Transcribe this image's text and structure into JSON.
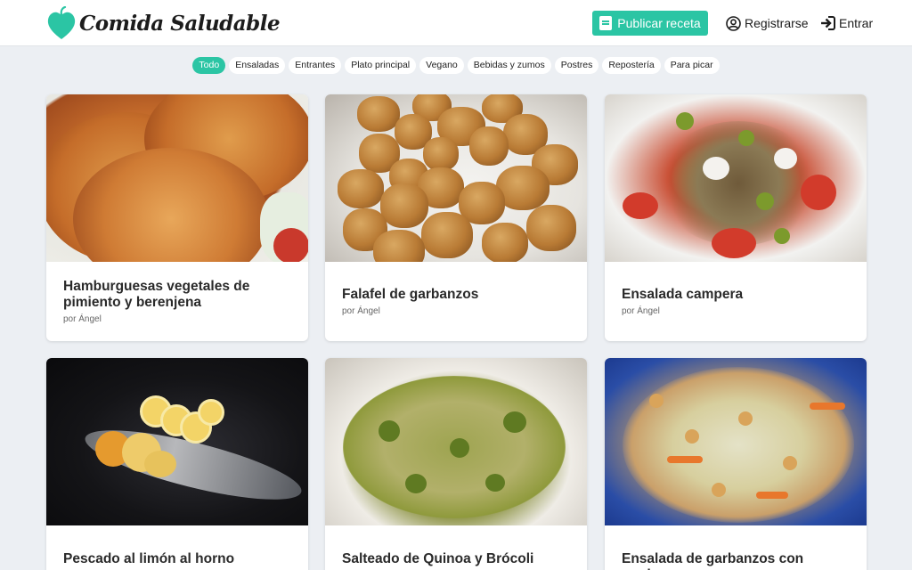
{
  "brand": {
    "name": "Comida Saludable",
    "accent": "#2bc5a4"
  },
  "nav": {
    "publish_label": "Publicar receta",
    "register_label": "Registrarse",
    "login_label": "Entrar"
  },
  "filters": [
    {
      "label": "Todo",
      "active": true
    },
    {
      "label": "Ensaladas",
      "active": false
    },
    {
      "label": "Entrantes",
      "active": false
    },
    {
      "label": "Plato principal",
      "active": false
    },
    {
      "label": "Vegano",
      "active": false
    },
    {
      "label": "Bebidas y zumos",
      "active": false
    },
    {
      "label": "Postres",
      "active": false
    },
    {
      "label": "Repostería",
      "active": false
    },
    {
      "label": "Para picar",
      "active": false
    }
  ],
  "recipes": [
    {
      "title": "Hamburguesas vegetales de pimiento y berenjena",
      "author": "por Ángel",
      "photo": "burger-photo"
    },
    {
      "title": "Falafel de garbanzos",
      "author": "por Ángel",
      "photo": "falafel-photo"
    },
    {
      "title": "Ensalada campera",
      "author": "por Ángel",
      "photo": "salad-photo"
    },
    {
      "title": "Pescado al limón al horno",
      "author": "",
      "photo": "fish-photo"
    },
    {
      "title": "Salteado de Quinoa y Brócoli",
      "author": "",
      "photo": "quinoa-photo"
    },
    {
      "title": "Ensalada de garbanzos con verdura",
      "author": "",
      "photo": "chickpea-photo"
    }
  ]
}
